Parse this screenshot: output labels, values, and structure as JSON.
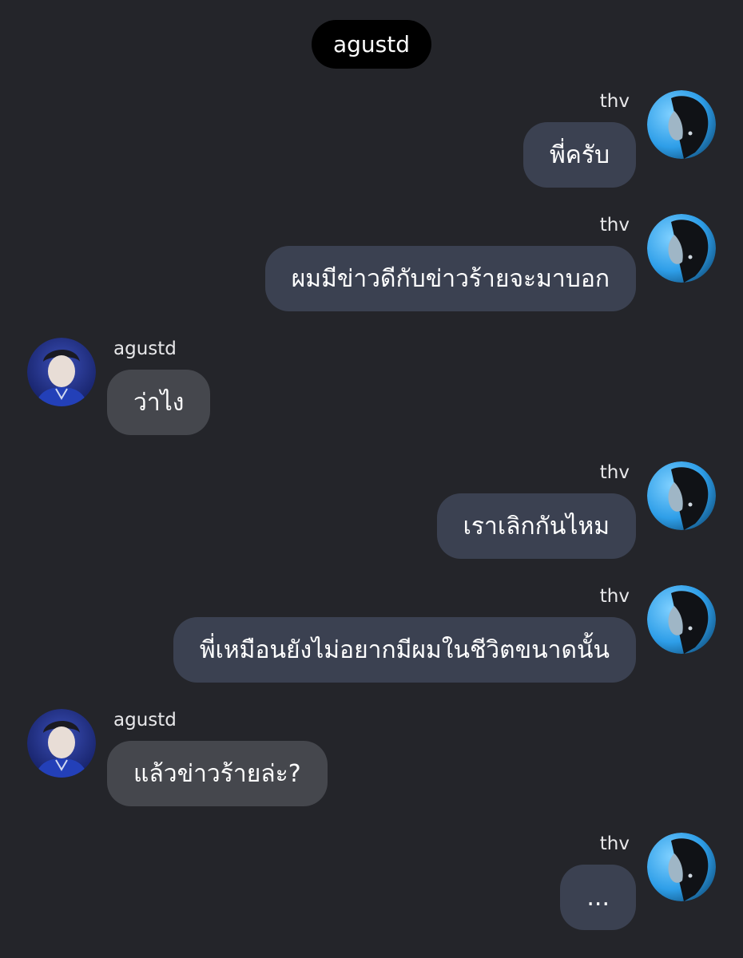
{
  "header": {
    "title": "agustd"
  },
  "messages": [
    {
      "sender": "thv",
      "text": "พี่ครับ",
      "side": "right"
    },
    {
      "sender": "thv",
      "text": "ผมมีข่าวดีกับข่าวร้ายจะมาบอก",
      "side": "right"
    },
    {
      "sender": "agustd",
      "text": "ว่าไง",
      "side": "left"
    },
    {
      "sender": "thv",
      "text": "เราเลิกกันไหม",
      "side": "right"
    },
    {
      "sender": "thv",
      "text": "พี่เหมือนยังไม่อยากมีผมในชีวิตขนาดนั้น",
      "side": "right"
    },
    {
      "sender": "agustd",
      "text": "แล้วข่าวร้ายล่ะ?",
      "side": "left"
    },
    {
      "sender": "thv",
      "text": "...",
      "side": "right"
    }
  ],
  "colors": {
    "background": "#24252a",
    "header_pill": "#000000",
    "outgoing_bubble": "#3b4151",
    "incoming_bubble": "#45474d",
    "text": "#ffffff"
  },
  "avatars": {
    "thv": "profile-photo-thv",
    "agustd": "profile-photo-agustd"
  }
}
